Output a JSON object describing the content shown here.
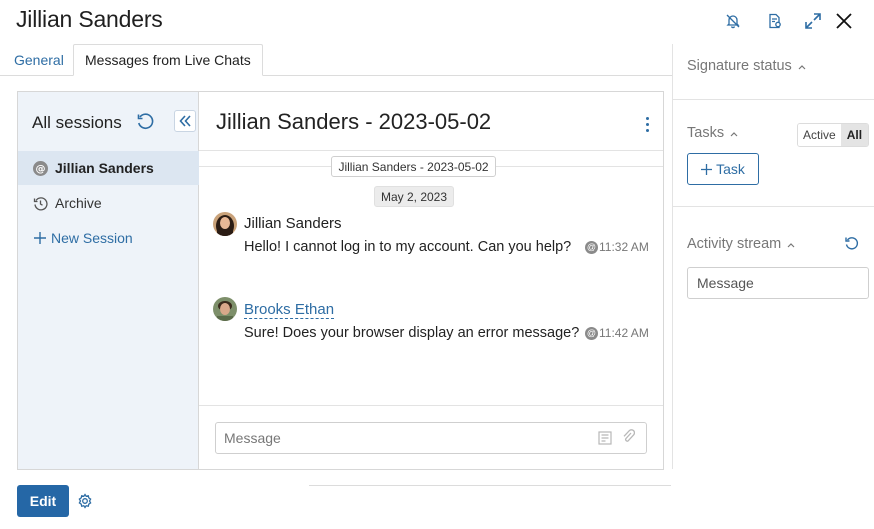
{
  "header": {
    "title": "Jillian Sanders",
    "icons": [
      "bell-off-icon",
      "document-settings-icon",
      "expand-icon",
      "close-icon"
    ]
  },
  "tabs": [
    {
      "label": "General",
      "active": false
    },
    {
      "label": "Messages from Live Chats",
      "active": true
    }
  ],
  "sessions": {
    "title": "All sessions",
    "items": [
      {
        "label": "Jillian Sanders",
        "icon": "at-icon",
        "selected": true
      },
      {
        "label": "Archive",
        "icon": "history-icon",
        "selected": false
      }
    ],
    "new_session": "New Session"
  },
  "conversation": {
    "title": "Jillian Sanders - 2023-05-02",
    "session_pill": "Jillian Sanders - 2023-05-02",
    "date_pill": "May 2, 2023",
    "messages": [
      {
        "author": "Jillian Sanders",
        "text": "Hello! I cannot log in to my account. Can you help?",
        "time": "11:32 AM"
      },
      {
        "author": "Brooks Ethan",
        "text": "Sure! Does your browser display an error message?",
        "time": "11:42 AM"
      }
    ],
    "compose_placeholder": "Message"
  },
  "right_panel": {
    "signature_label": "Signature status",
    "tasks_label": "Tasks",
    "filter_active": "Active",
    "filter_all": "All",
    "task_button": "Task",
    "activity_label": "Activity stream",
    "activity_placeholder": "Message"
  },
  "footer": {
    "edit_label": "Edit"
  },
  "colors": {
    "accent": "#2e6da4",
    "primary_button": "#2567a6",
    "sessions_bg": "#eef3f9",
    "selected_bg": "#dce6f1"
  }
}
